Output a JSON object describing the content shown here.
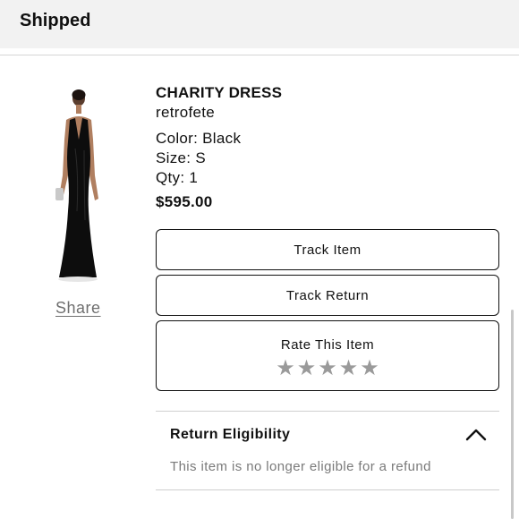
{
  "header": {
    "title": "Shipped"
  },
  "product": {
    "name": "CHARITY DRESS",
    "brand": "retrofete",
    "color": "Color: Black",
    "size": "Size: S",
    "qty": "Qty: 1",
    "price": "$595.00",
    "share_label": "Share"
  },
  "actions": {
    "track_item": "Track Item",
    "track_return": "Track Return",
    "rate_label": "Rate This Item",
    "rating_value": 0,
    "rating_max": 5
  },
  "return_eligibility": {
    "title": "Return Eligibility",
    "message": "This item is no longer eligible for a refund",
    "expanded": true
  }
}
